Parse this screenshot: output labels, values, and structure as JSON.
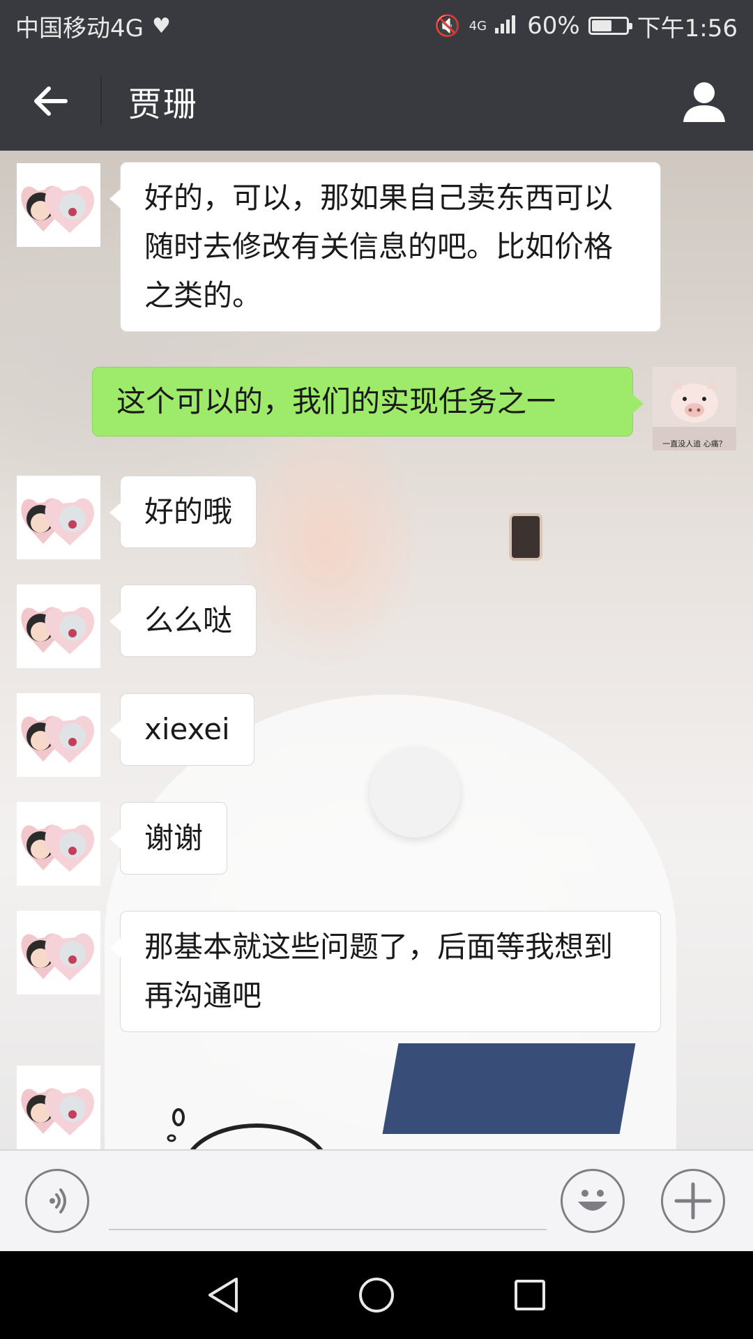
{
  "status_bar": {
    "carrier": "中国移动4G",
    "network": "4G",
    "battery": "60%",
    "battery_level": 0.6,
    "time": "下午1:56"
  },
  "header": {
    "title": "贾珊"
  },
  "messages": [
    {
      "side": "left",
      "text": "好的，可以，那如果自己卖东西可以随时去修改有关信息的吧。比如价格之类的。"
    },
    {
      "side": "right",
      "text": "这个可以的，我们的实现任务之一"
    },
    {
      "side": "left",
      "text": "好的哦"
    },
    {
      "side": "left",
      "text": "么么哒"
    },
    {
      "side": "left",
      "text": "xiexei"
    },
    {
      "side": "left",
      "text": "谢谢"
    },
    {
      "side": "left",
      "text": "那基本就这些问题了，后面等我想到再沟通吧"
    },
    {
      "side": "left",
      "text": ""
    }
  ],
  "my_avatar_caption": "一直没人追 心痛？",
  "input": {
    "value": "",
    "placeholder": ""
  },
  "icons": {
    "back": "arrow-left-icon",
    "profile": "person-icon",
    "voice": "voice-icon",
    "emoji": "emoji-icon",
    "more": "plus-icon"
  },
  "colors": {
    "header_bg": "#393a3f",
    "sent_bubble": "#9eea6a",
    "received_bubble": "#ffffff"
  }
}
